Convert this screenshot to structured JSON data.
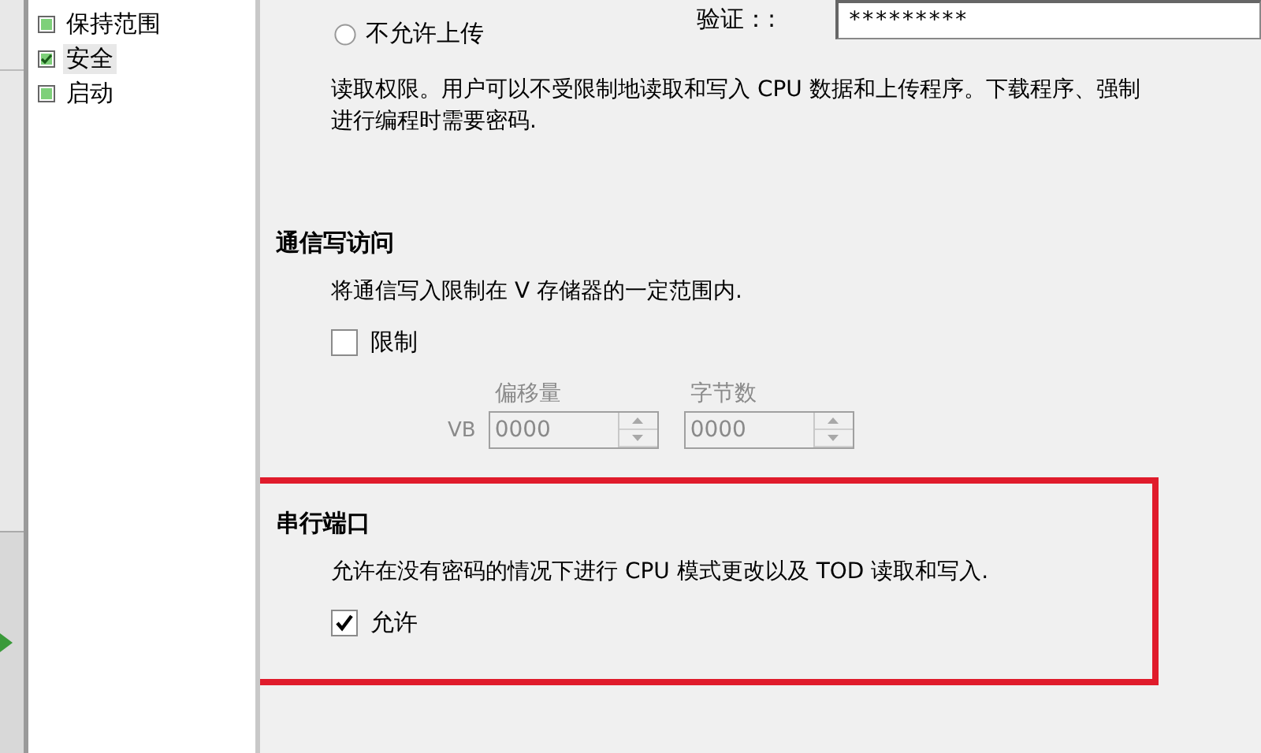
{
  "tree": {
    "items": [
      {
        "label": "保持范围",
        "checked": false,
        "selected": false
      },
      {
        "label": "安全",
        "checked": true,
        "selected": true
      },
      {
        "label": "启动",
        "checked": false,
        "selected": false
      }
    ]
  },
  "password": {
    "label": "验证：:",
    "value": "*********"
  },
  "upload_radio": {
    "label": "不允许上传",
    "selected": false
  },
  "access_description": [
    "读取权限。用户可以不受限制地读取和写入 CPU 数据和上传程序。下载程序、强制",
    "进行编程时需要密码."
  ],
  "comm_write": {
    "heading": "通信写访问",
    "description": "将通信写入限制在 V 存储器的一定范围内.",
    "restrict": {
      "label": "限制",
      "checked": false
    },
    "prefix": "VB",
    "offset": {
      "label": "偏移量",
      "value": "0000",
      "disabled": true
    },
    "bytes": {
      "label": "字节数",
      "value": "0000",
      "disabled": true
    }
  },
  "serial_port": {
    "heading": "串行端口",
    "description": "允许在没有密码的情况下进行 CPU 模式更改以及 TOD 读取和写入.",
    "allow": {
      "label": "允许",
      "checked": true
    },
    "highlighted": true
  }
}
